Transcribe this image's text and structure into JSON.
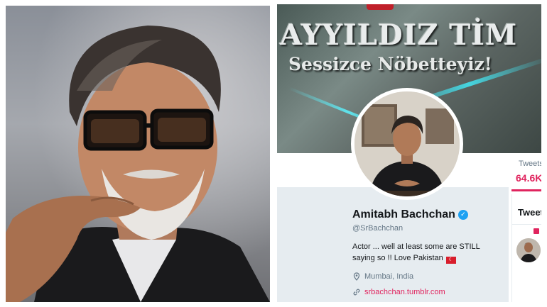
{
  "banner": {
    "title": "AYYILDIZ TİM",
    "subtitle": "Sessizce Nöbetteyiz!"
  },
  "profile": {
    "name": "Amitabh Bachchan",
    "handle": "@SrBachchan",
    "bio": "Actor ... well at least some are STILL saying so !! Love Pakistan",
    "location": "Mumbai, India",
    "link": "srbachchan.tumblr.com",
    "verified_icon": "verified-badge-icon"
  },
  "stats": {
    "tweets_label": "Tweets",
    "tweets_value": "64.6K"
  },
  "tweets_section": {
    "heading": "Tweets"
  },
  "colors": {
    "accent": "#e0245e",
    "verified": "#1da1f2",
    "card_bg": "#e6ecf0"
  }
}
